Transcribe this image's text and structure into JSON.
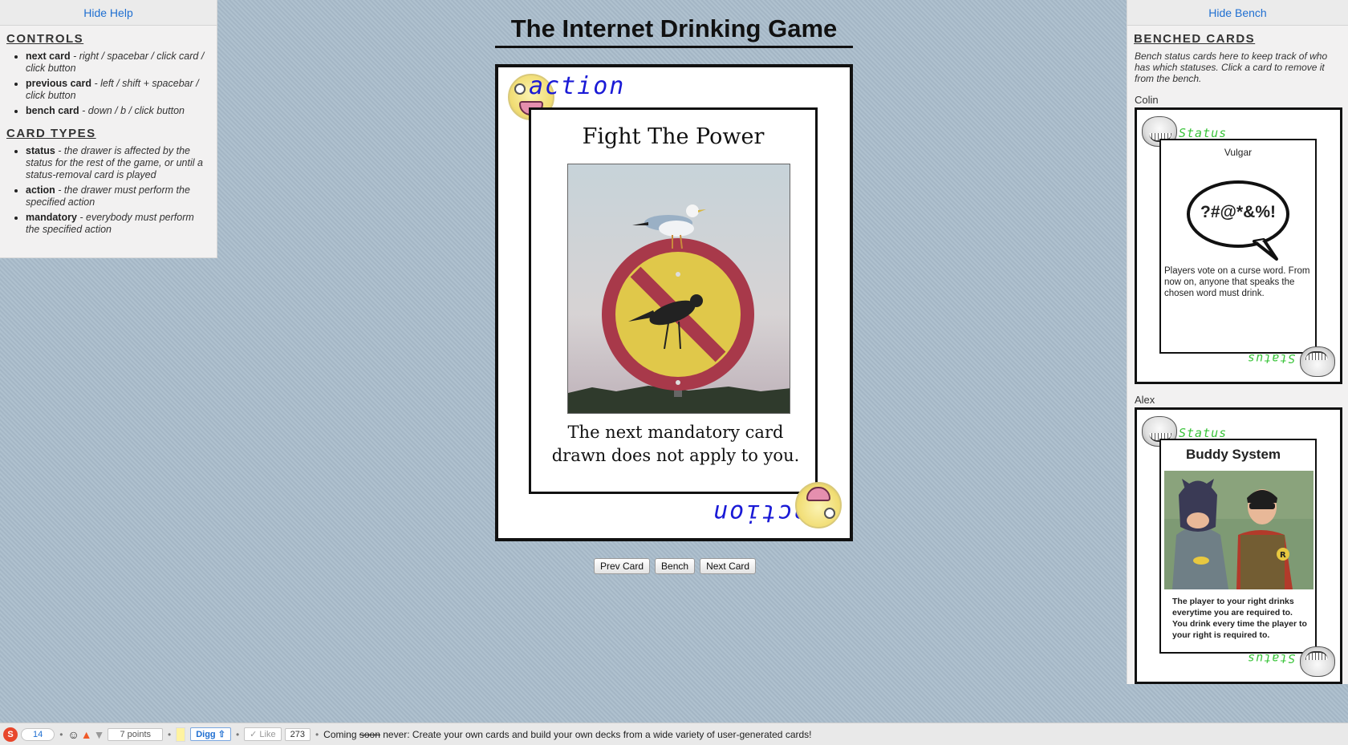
{
  "help": {
    "toggle_label": "Hide Help",
    "controls_heading": "CONTROLS",
    "controls": [
      {
        "name": "next card",
        "desc": " - right / spacebar / click card / click button"
      },
      {
        "name": "previous card",
        "desc": " - left / shift + spacebar / click button"
      },
      {
        "name": "bench card",
        "desc": " - down / b / click button"
      }
    ],
    "types_heading": "CARD TYPES",
    "types": [
      {
        "name": "status",
        "desc": " - the drawer is affected by the status for the rest of the game, or until a status-removal card is played"
      },
      {
        "name": "action",
        "desc": " - the drawer must perform the specified action"
      },
      {
        "name": "mandatory",
        "desc": " - everybody must perform the specified action"
      }
    ]
  },
  "title": "The Internet Drinking Game",
  "card": {
    "type_label": "action",
    "title": "Fight The Power",
    "image_icon": "seagull-on-no-birds-sign-photo",
    "text": "The next mandatory card drawn does not apply to you."
  },
  "buttons": {
    "prev": "Prev Card",
    "bench": "Bench",
    "next": "Next Card"
  },
  "bench": {
    "toggle_label": "Hide Bench",
    "heading": "BENCHED CARDS",
    "description": "Bench status cards here to keep track of who has which statuses. Click a card to remove it from the bench.",
    "cards": [
      {
        "player": "Colin",
        "type_label": "Status",
        "title": "Vulgar",
        "bubble_text": "?#@*&%!",
        "text": "Players vote on a curse word. From now on, anyone that speaks the chosen word must drink."
      },
      {
        "player": "Alex",
        "type_label": "Status",
        "title": "Buddy System",
        "image_icon": "batman-and-robin-photo",
        "text": "The player to your right drinks everytime you are required to. You drink every time the player to your right is required to."
      }
    ]
  },
  "footer": {
    "stumble_count": "14",
    "reddit_points": "7 points",
    "digg_label": "Digg",
    "like_label": "Like",
    "like_count": "273",
    "coming_prefix": "Coming ",
    "coming_struck": "soon",
    "coming_word": " never",
    "coming_text": ": Create your own cards and build your own decks from a wide variety of user-generated cards!"
  },
  "colors": {
    "link": "#1f6fd1",
    "action_label": "#1a1ad6",
    "status_label": "#3ac43a",
    "background": "#a9bccb"
  }
}
